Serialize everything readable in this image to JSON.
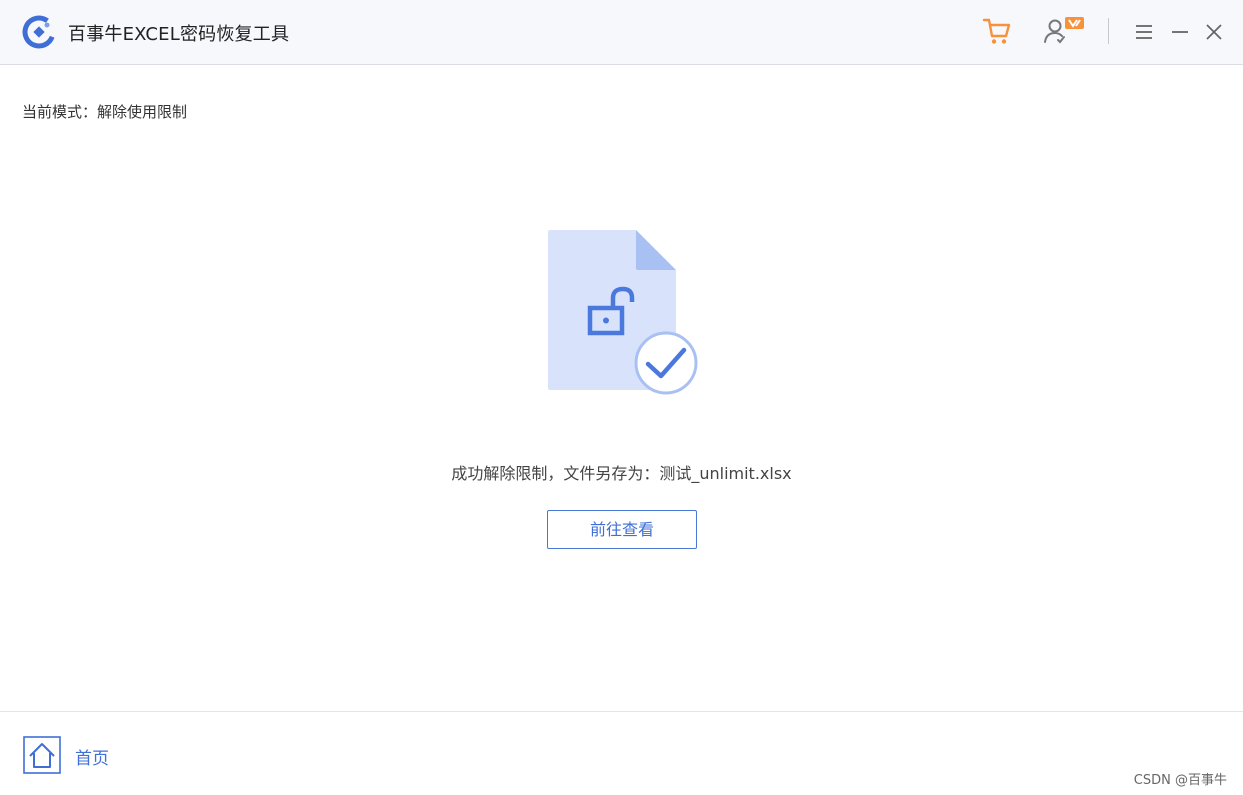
{
  "titlebar": {
    "app_title": "百事牛EXCEL密码恢复工具",
    "icons": [
      "app-logo",
      "cart-icon",
      "user-vip-icon",
      "menu-icon",
      "minimize-icon",
      "close-icon"
    ],
    "colors": {
      "accent_orange": "#f7923a",
      "brand_blue": "#3f6fd6"
    }
  },
  "main": {
    "mode_label": "当前模式：解除使用限制",
    "result_message": "成功解除限制，文件另存为：测试_unlimit.xlsx",
    "view_button_label": "前往查看",
    "illustration": {
      "icons": [
        "file-icon",
        "unlock-icon",
        "checkmark-icon"
      ]
    }
  },
  "footer": {
    "home_label": "首页",
    "home_icon": "home-icon"
  },
  "watermark": "CSDN @百事牛"
}
